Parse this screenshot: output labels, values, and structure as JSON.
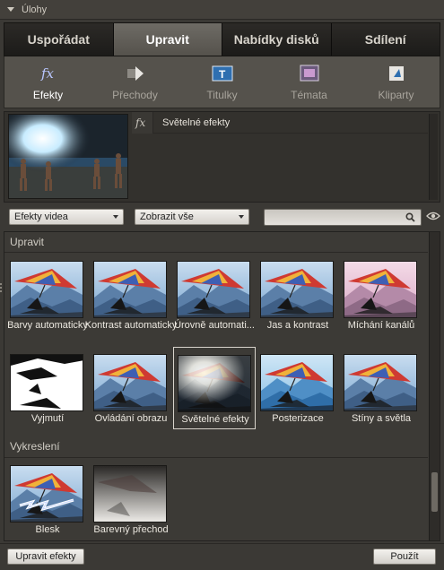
{
  "panel": {
    "title": "Úlohy"
  },
  "tabs": [
    {
      "label": "Uspořádat",
      "active": false
    },
    {
      "label": "Upravit",
      "active": true
    },
    {
      "label": "Nabídky disků",
      "active": false
    },
    {
      "label": "Sdílení",
      "active": false
    }
  ],
  "subtabs": [
    {
      "label": "Efekty",
      "icon": "fx-icon",
      "active": true
    },
    {
      "label": "Přechody",
      "icon": "transition-arrow-icon",
      "active": false
    },
    {
      "label": "Titulky",
      "icon": "title-t-icon",
      "active": false
    },
    {
      "label": "Témata",
      "icon": "themes-icon",
      "active": false
    },
    {
      "label": "Kliparty",
      "icon": "clipart-icon",
      "active": false
    }
  ],
  "preview": {
    "effect_name": "Světelné efekty",
    "effect_icon": "fx-icon"
  },
  "filters": {
    "category": "Efekty videa",
    "show": "Zobrazit vše",
    "search_value": "",
    "search_icon": "search-icon",
    "visibility_icon": "eye-icon"
  },
  "sections": [
    {
      "label": "Upravit",
      "items": [
        {
          "label": "Barvy automaticky",
          "style": "normal",
          "selected": false
        },
        {
          "label": "Kontrast automaticky",
          "style": "normal",
          "selected": false
        },
        {
          "label": "Úrovně automati...",
          "style": "normal",
          "selected": false
        },
        {
          "label": "Jas a kontrast",
          "style": "normal",
          "selected": false
        },
        {
          "label": "Míchání kanálů",
          "style": "pink",
          "selected": false
        },
        {
          "label": "Vyjmutí",
          "style": "mask",
          "selected": false
        },
        {
          "label": "Ovládání obrazu",
          "style": "normal",
          "selected": false
        },
        {
          "label": "Světelné efekty",
          "style": "light",
          "selected": true
        },
        {
          "label": "Posterizace",
          "style": "poster",
          "selected": false
        },
        {
          "label": "Stíny a světla",
          "style": "normal",
          "selected": false
        }
      ]
    },
    {
      "label": "Vykreslení",
      "items": [
        {
          "label": "Blesk",
          "style": "lightning",
          "selected": false
        },
        {
          "label": "Barevný přechod",
          "style": "ramp",
          "selected": false
        }
      ]
    }
  ],
  "buttons": {
    "edit_effects": "Upravit efekty",
    "apply": "Použít"
  },
  "colors": {
    "panel_bg": "#3b3935",
    "active_tab": "#6e6b65",
    "selected_border": "#d8d4cc"
  }
}
